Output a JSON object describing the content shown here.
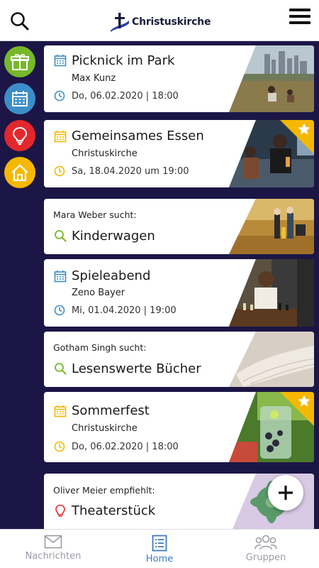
{
  "header": {
    "app_name": "Christuskirche"
  },
  "cards": [
    {
      "title": "Picknick im Park",
      "subtitle": "Max Kunz",
      "date": "Do, 06.02.2020 | 18:00"
    },
    {
      "title": "Gemeinsames Essen",
      "subtitle": "Christuskirche",
      "date": "Sa, 18.04.2020 um 19:00"
    },
    {
      "who_name": "Mara Weber",
      "who_action": " sucht:",
      "title": "Kinderwagen"
    },
    {
      "title": "Spieleabend",
      "subtitle": "Zeno Bayer",
      "date": "Mi, 01.04.2020 | 19:00"
    },
    {
      "who_name": "Gotham Singh",
      "who_action": " sucht:",
      "title": "Lesenswerte Bücher"
    },
    {
      "title": "Sommerfest",
      "subtitle": "Christuskirche",
      "date": "Do, 06.02.2020 | 18:00"
    },
    {
      "who_name": "Oliver Meier",
      "who_action": " empfiehlt:",
      "title": "Theaterstück"
    }
  ],
  "nav": {
    "tabs": [
      {
        "label": "Nachrichten",
        "icon": "mail-icon"
      },
      {
        "label": "Home",
        "icon": "list-icon",
        "active": true
      },
      {
        "label": "Gruppen",
        "icon": "group-icon"
      }
    ]
  },
  "colors": {
    "background": "#1c1646",
    "green": "#76b82a",
    "blue": "#3c8ec9",
    "red": "#e2282c",
    "yellow": "#f5b800",
    "active_tab": "#3c7ac9"
  }
}
